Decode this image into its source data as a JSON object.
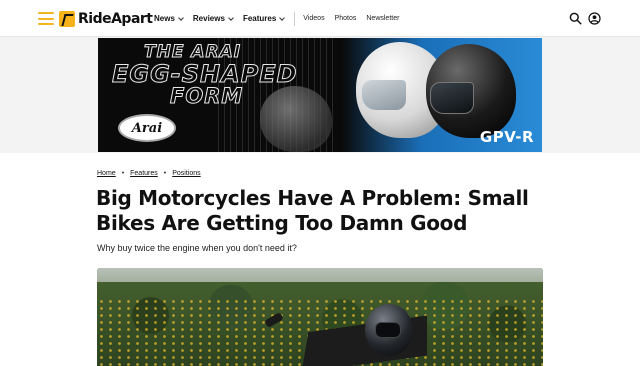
{
  "header": {
    "logo_text": "RideApart",
    "nav": [
      {
        "label": "News",
        "has_dropdown": true
      },
      {
        "label": "Reviews",
        "has_dropdown": true
      },
      {
        "label": "Features",
        "has_dropdown": true
      }
    ],
    "nav_plain": [
      "Videos",
      "Photos",
      "Newsletter"
    ],
    "accent_color": "#f6b21b"
  },
  "ad": {
    "line1": "THE ARAI",
    "line2": "EGG-SHAPED",
    "line3": "FORM",
    "brand": "Arai",
    "model": "GPV-R"
  },
  "breadcrumb": [
    "Home",
    "Features",
    "Positions"
  ],
  "article": {
    "title": "Big Motorcycles Have A Problem: Small Bikes Are Getting Too Damn Good",
    "subtitle": "Why buy twice the engine when you don't need it?"
  },
  "icons": {
    "menu": "hamburger-icon",
    "search": "search-icon",
    "account": "user-icon"
  }
}
